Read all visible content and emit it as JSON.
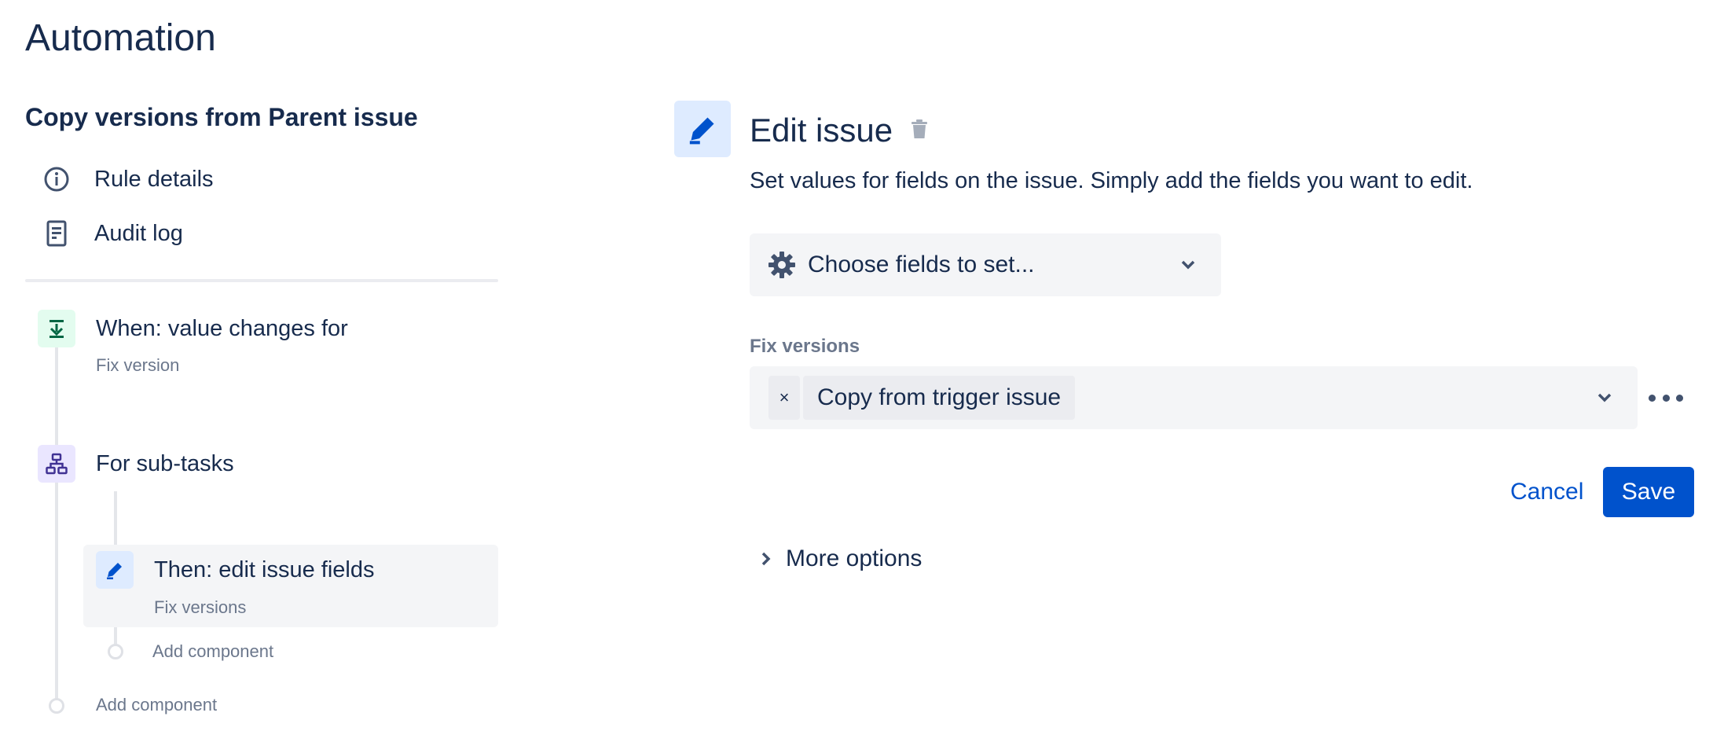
{
  "page": {
    "title": "Automation"
  },
  "rule": {
    "name": "Copy versions from Parent issue"
  },
  "nav": [
    {
      "label": "Rule details",
      "icon": "info-icon"
    },
    {
      "label": "Audit log",
      "icon": "document-icon"
    }
  ],
  "flow": {
    "trigger": {
      "title": "When: value changes for",
      "subtitle": "Fix version",
      "icon": "trigger-download-icon",
      "color": "#e3fcef"
    },
    "branch": {
      "title": "For sub-tasks",
      "icon": "hierarchy-icon",
      "color": "#eae6ff"
    },
    "action": {
      "title": "Then: edit issue fields",
      "subtitle": "Fix versions",
      "icon": "pencil-icon",
      "color": "#deebff"
    },
    "add_component_inner": "Add component",
    "add_component_outer": "Add component"
  },
  "panel": {
    "title": "Edit issue",
    "description": "Set values for fields on the issue. Simply add the fields you want to edit.",
    "choose_fields": "Choose fields to set...",
    "field_label": "Fix versions",
    "field_value": "Copy from trigger issue",
    "remove_tag": "×",
    "cancel": "Cancel",
    "save": "Save",
    "more_options": "More options"
  },
  "colors": {
    "primary": "#0052cc",
    "text": "#172b4d",
    "subtle": "#6b778c",
    "surface": "#f4f5f7"
  }
}
